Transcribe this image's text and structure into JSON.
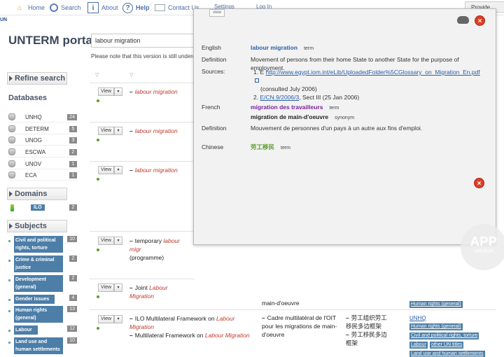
{
  "nav": {
    "home": "Home",
    "search": "Search",
    "about": "About",
    "help": "Help",
    "contact": "Contact Us",
    "settings": "Settings",
    "login": "Log In",
    "provide": "Provide"
  },
  "logo": "UN",
  "portal_title": "UNTERM portal",
  "search": {
    "value": "labour migration"
  },
  "notice": "Please note that this version is still undergoing",
  "sidebar": {
    "refine": "Refine search",
    "databases_title": "Databases",
    "databases": [
      {
        "name": "UNHQ",
        "count": "24"
      },
      {
        "name": "DETERM",
        "count": "5"
      },
      {
        "name": "UNOG",
        "count": "3"
      },
      {
        "name": "ESCWA",
        "count": "2"
      },
      {
        "name": "UNOV",
        "count": "1"
      },
      {
        "name": "ECA",
        "count": "1"
      }
    ],
    "domains_title": "Domains",
    "domains": [
      {
        "name": "ILO",
        "count": "2"
      }
    ],
    "subjects_title": "Subjects",
    "subjects": [
      {
        "name": "Civil and political rights, torture",
        "count": "10"
      },
      {
        "name": "Crime & criminal justice",
        "count": "2"
      },
      {
        "name": "Development (general)",
        "count": "2"
      },
      {
        "name": "Gender issues",
        "count": "4"
      },
      {
        "name": "Human rights (general)",
        "count": "13"
      },
      {
        "name": "Labour",
        "count": "12"
      },
      {
        "name": "Land use and human settlements",
        "count": "10"
      }
    ]
  },
  "results": {
    "view_label": "View",
    "dropdown": "▾",
    "sort": "▽",
    "rows": [
      {
        "pre": "",
        "term": "labour migration",
        "post": ""
      },
      {
        "pre": "",
        "term": "labour migration",
        "post": ""
      },
      {
        "pre": "",
        "term": "labour migration",
        "post": ""
      },
      {
        "pre": "temporary ",
        "term": "labour migr",
        "post": "(programme)"
      },
      {
        "pre": "Joint ",
        "term": "Labour Migration",
        "post": ""
      },
      {
        "pre": "ILO Multilateral Framework on ",
        "term": "Labour Migration",
        "post": ""
      }
    ],
    "last_row_extra": {
      "pre": "Multilateral Framework on ",
      "term": "Labour Migration"
    },
    "peek_fr": "main-d'oeuvre",
    "last_fr": "Cadre multilatéral de l'OIT pour les migrations de main-d'oeuvre",
    "last_zh_1": "劳工组织劳工移民多边框架",
    "last_zh_2": "劳工移民多边框架",
    "src_peek_tag": "Human rights (general)",
    "last_src": {
      "link": "UNHQ",
      "tags": [
        "Human rights (general)",
        "Civil and political rights, torture",
        "Labour",
        "other UN titles",
        "Land use and human settlements"
      ]
    }
  },
  "modal": {
    "view_label": "view",
    "close": "×",
    "english_label": "English",
    "english_term": "labour migration",
    "term_tag": "term",
    "definition_label": "Definition",
    "definition_en": "Movement of persons from their home State to another State for the purpose of employment.",
    "sources_label": "Sources:",
    "source1_num": "1.",
    "source1_prefix": "E",
    "source1_link": "http://www.egypt.iom.int/eLib/UploadedFolder%5CGlossary_on_Migration_En.pdf",
    "source1_note": "(consulted July 2006)",
    "source2_num": "2.",
    "source2_link": "E/CN.9/2006/3",
    "source2_note": ", Sect III (25 Jan 2006)",
    "french_label": "French",
    "french_term": "migration des travailleurs",
    "french_syn": "migration de main-d'oeuvre",
    "synonym_tag": "synonym",
    "definition_fr": "Mouvement de personnes d'un pays à un autre aux fins d'emploi.",
    "chinese_label": "Chinese",
    "chinese_term": "劳工移民"
  },
  "watermark": {
    "big": "APP",
    "small": "solution"
  }
}
